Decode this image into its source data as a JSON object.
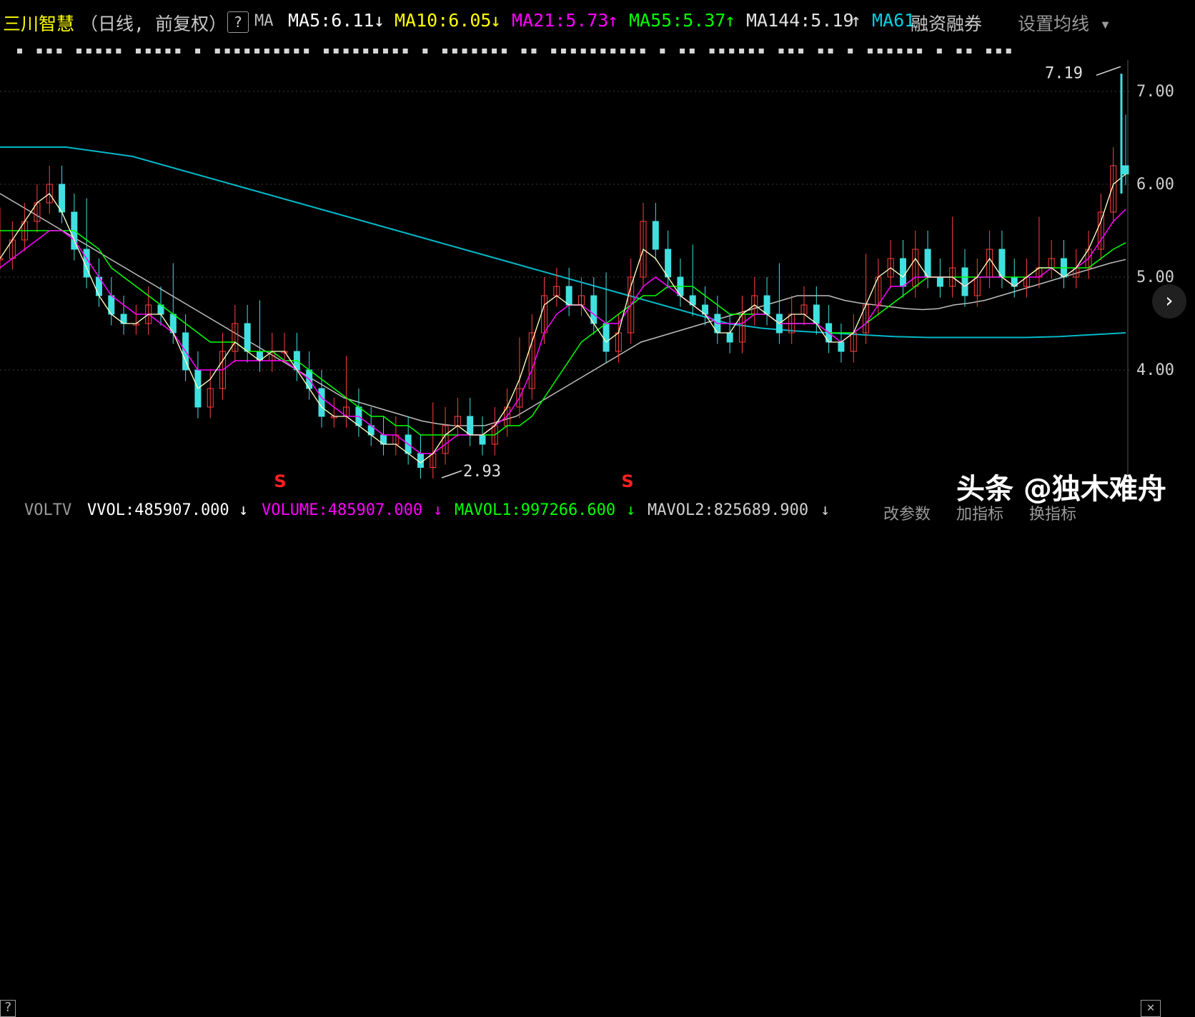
{
  "header": {
    "stock_name": "三川智慧",
    "mode": "（日线, 前复权）",
    "help": "?",
    "ma_label": "MA",
    "ma5": "MA5:6.11",
    "ma5_arrow": "↓",
    "ma10": "MA10:6.05",
    "ma10_arrow": "↓",
    "ma21": "MA21:5.73",
    "ma21_arrow": "↑",
    "ma55": "MA55:5.37",
    "ma55_arrow": "↑",
    "ma144": "MA144:5.19",
    "ma144_arrow": "↑",
    "ma61": "MA61",
    "margin": "融资融券",
    "settings": "设置均线 ▾",
    "colors": {
      "ma5": "#ffffff",
      "ma10": "#ffff00",
      "ma21": "#ff00ff",
      "ma55": "#00ff00",
      "ma144": "#d0d0d0",
      "ma61": "#00d0e0"
    }
  },
  "signal_row": "▪ ▪▪▪ ▪▪▪▪▪   ▪▪▪▪▪ ▪   ▪▪▪▪▪▪▪▪▪▪  ▪▪▪▪▪▪▪▪▪ ▪   ▪▪▪▪▪▪▪ ▪▪  ▪▪▪▪▪▪▪▪▪▪ ▪ ▪▪  ▪▪▪▪▪▪ ▪▪▪  ▪▪ ▪ ▪▪▪▪▪▪ ▪ ▪▪   ▪▪▪",
  "price_axis": [
    "7.00",
    "6.00",
    "5.00",
    "4.00"
  ],
  "annotations": {
    "high": "7.19",
    "low": "2.93",
    "s_marker": "S"
  },
  "footer": {
    "help": "?",
    "indicator": "VOLTV",
    "vvol": "VVOL:485907.000",
    "vvol_arrow": "↓",
    "volume": "VOLUME:485907.000",
    "volume_arrow": "↓",
    "mavol1": "MAVOL1:997266.600",
    "mavol1_arrow": "↓",
    "mavol2": "MAVOL2:825689.900",
    "mavol2_arrow": "↓",
    "change_params": "改参数",
    "add_indicator": "加指标",
    "switch_indicator": "换指标",
    "close": "✕"
  },
  "watermark": "头条 @独木难舟",
  "chart_data": {
    "type": "candlestick",
    "title": "三川智慧（日线, 前复权）",
    "ylim": [
      2.7,
      7.3
    ],
    "y_ticks": [
      4.0,
      5.0,
      6.0,
      7.0
    ],
    "annotations": [
      {
        "label": "7.19",
        "value": 7.19
      },
      {
        "label": "2.93",
        "value": 2.93
      }
    ],
    "close_path": [
      5.2,
      5.4,
      5.6,
      5.8,
      6.0,
      5.7,
      5.3,
      5.0,
      4.8,
      4.6,
      4.5,
      4.5,
      4.7,
      4.6,
      4.4,
      4.0,
      3.6,
      3.8,
      4.2,
      4.5,
      4.2,
      4.1,
      4.2,
      4.2,
      4.0,
      3.8,
      3.5,
      3.5,
      3.6,
      3.4,
      3.3,
      3.2,
      3.3,
      3.1,
      2.95,
      3.1,
      3.4,
      3.5,
      3.3,
      3.2,
      3.4,
      3.6,
      3.8,
      4.4,
      4.8,
      4.9,
      4.7,
      4.8,
      4.5,
      4.2,
      4.4,
      5.0,
      5.6,
      5.3,
      5.0,
      4.8,
      4.7,
      4.6,
      4.4,
      4.3,
      4.6,
      4.8,
      4.6,
      4.4,
      4.6,
      4.7,
      4.5,
      4.3,
      4.2,
      4.4,
      4.7,
      5.0,
      5.2,
      4.9,
      5.3,
      5.0,
      4.9,
      5.1,
      4.8,
      5.0,
      5.3,
      5.0,
      4.9,
      5.0,
      5.1,
      5.2,
      5.0,
      5.1,
      5.3,
      5.7,
      6.2,
      6.11
    ],
    "ma5": [
      5.2,
      5.4,
      5.6,
      5.8,
      5.9,
      5.7,
      5.4,
      5.1,
      4.8,
      4.6,
      4.5,
      4.5,
      4.6,
      4.6,
      4.4,
      4.1,
      3.8,
      3.9,
      4.1,
      4.3,
      4.2,
      4.1,
      4.2,
      4.2,
      4.0,
      3.8,
      3.6,
      3.5,
      3.5,
      3.4,
      3.3,
      3.2,
      3.2,
      3.1,
      3.0,
      3.1,
      3.3,
      3.4,
      3.3,
      3.3,
      3.4,
      3.6,
      3.9,
      4.3,
      4.7,
      4.8,
      4.7,
      4.7,
      4.5,
      4.3,
      4.4,
      4.9,
      5.3,
      5.2,
      5.0,
      4.8,
      4.7,
      4.6,
      4.4,
      4.4,
      4.6,
      4.7,
      4.6,
      4.5,
      4.6,
      4.6,
      4.5,
      4.3,
      4.3,
      4.4,
      4.7,
      5.0,
      5.1,
      5.0,
      5.2,
      5.0,
      5.0,
      5.0,
      4.9,
      5.0,
      5.2,
      5.0,
      4.9,
      5.0,
      5.1,
      5.1,
      5.0,
      5.1,
      5.3,
      5.6,
      6.0,
      6.11
    ],
    "ma21": [
      5.1,
      5.2,
      5.3,
      5.4,
      5.5,
      5.5,
      5.4,
      5.2,
      5.0,
      4.8,
      4.7,
      4.6,
      4.6,
      4.5,
      4.4,
      4.2,
      4.0,
      4.0,
      4.0,
      4.1,
      4.1,
      4.1,
      4.1,
      4.1,
      4.0,
      3.9,
      3.7,
      3.6,
      3.5,
      3.5,
      3.4,
      3.3,
      3.3,
      3.2,
      3.1,
      3.1,
      3.2,
      3.3,
      3.3,
      3.3,
      3.4,
      3.5,
      3.7,
      4.0,
      4.4,
      4.6,
      4.7,
      4.7,
      4.6,
      4.5,
      4.5,
      4.7,
      4.9,
      5.0,
      4.9,
      4.8,
      4.7,
      4.6,
      4.5,
      4.5,
      4.5,
      4.6,
      4.6,
      4.5,
      4.5,
      4.5,
      4.5,
      4.4,
      4.3,
      4.4,
      4.5,
      4.7,
      4.9,
      4.9,
      5.0,
      5.0,
      5.0,
      5.0,
      4.9,
      5.0,
      5.0,
      5.0,
      4.9,
      5.0,
      5.0,
      5.1,
      5.0,
      5.1,
      5.2,
      5.4,
      5.6,
      5.73
    ],
    "ma55": [
      5.5,
      5.5,
      5.5,
      5.5,
      5.5,
      5.5,
      5.5,
      5.4,
      5.3,
      5.1,
      5.0,
      4.9,
      4.8,
      4.7,
      4.6,
      4.5,
      4.4,
      4.3,
      4.3,
      4.3,
      4.2,
      4.2,
      4.2,
      4.1,
      4.1,
      4.0,
      3.9,
      3.8,
      3.7,
      3.6,
      3.5,
      3.5,
      3.4,
      3.4,
      3.3,
      3.3,
      3.3,
      3.3,
      3.3,
      3.3,
      3.3,
      3.4,
      3.4,
      3.5,
      3.7,
      3.9,
      4.1,
      4.3,
      4.4,
      4.5,
      4.6,
      4.7,
      4.8,
      4.8,
      4.9,
      4.9,
      4.9,
      4.8,
      4.7,
      4.6,
      4.6,
      4.6,
      4.6,
      4.5,
      4.5,
      4.5,
      4.5,
      4.4,
      4.4,
      4.4,
      4.5,
      4.6,
      4.7,
      4.8,
      4.9,
      5.0,
      5.0,
      5.0,
      5.0,
      5.0,
      5.0,
      5.0,
      5.0,
      5.0,
      5.1,
      5.1,
      5.1,
      5.1,
      5.1,
      5.2,
      5.3,
      5.37
    ],
    "ma144": [
      5.9,
      5.8,
      5.7,
      5.6,
      5.5,
      5.4,
      5.3,
      5.2,
      5.1,
      5.0,
      4.9,
      4.8,
      4.7,
      4.6,
      4.5,
      4.4,
      4.3,
      4.2,
      4.1,
      4.0,
      3.9,
      3.8,
      3.7,
      3.65,
      3.6,
      3.55,
      3.5,
      3.45,
      3.42,
      3.4,
      3.4,
      3.4,
      3.45,
      3.5,
      3.6,
      3.7,
      3.8,
      3.9,
      4.0,
      4.1,
      4.2,
      4.3,
      4.35,
      4.4,
      4.45,
      4.5,
      4.55,
      4.6,
      4.65,
      4.7,
      4.75,
      4.8,
      4.8,
      4.8,
      4.75,
      4.72,
      4.7,
      4.68,
      4.66,
      4.65,
      4.66,
      4.7,
      4.72,
      4.75,
      4.8,
      4.85,
      4.9,
      4.95,
      5.0,
      5.05,
      5.1,
      5.15,
      5.19
    ],
    "ma61_band": [
      6.4,
      6.4,
      6.4,
      6.35,
      6.3,
      6.2,
      6.1,
      6.0,
      5.9,
      5.8,
      5.7,
      5.6,
      5.5,
      5.4,
      5.3,
      5.2,
      5.1,
      5.0,
      4.9,
      4.8,
      4.7,
      4.6,
      4.5,
      4.45,
      4.42,
      4.4,
      4.38,
      4.36,
      4.35,
      4.35,
      4.35,
      4.35,
      4.36,
      4.38,
      4.4
    ],
    "candles_visible": true
  }
}
